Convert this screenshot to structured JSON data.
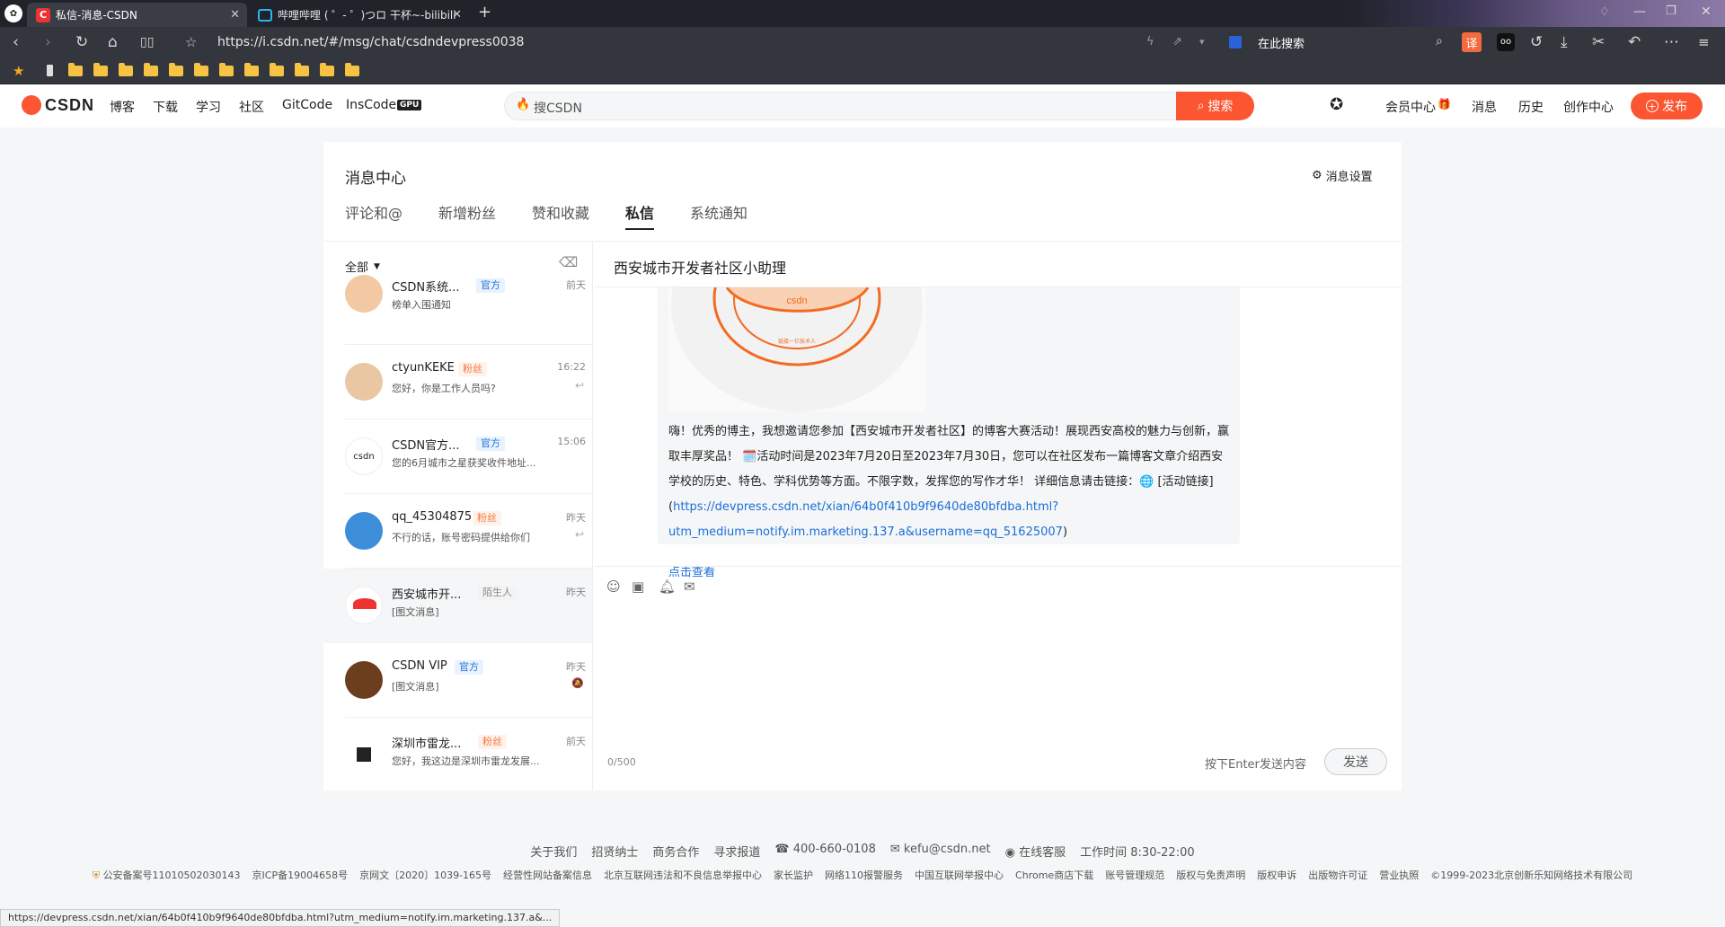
{
  "browser": {
    "tabs": [
      {
        "title": "私信-消息-CSDN"
      },
      {
        "title": "哔哩哔哩 ( ゜- ゜)つロ 干杯~-bilibili"
      }
    ],
    "new_tab": "+",
    "url": "https://i.csdn.net/#/msg/chat/csdndevpress0038",
    "search_placeholder": "在此搜索",
    "translate_label": "译",
    "status_url": "https://devpress.csdn.net/xian/64b0f410b9f9640de80bfdba.html?utm_medium=notify.im.marketing.137.a&..."
  },
  "csdn": {
    "logo": "CSDN",
    "nav": [
      "博客",
      "下载",
      "学习",
      "社区",
      "GitCode",
      "InsCode"
    ],
    "gpu_badge": "GPU",
    "search_placeholder": "搜CSDN",
    "search_button": "搜索",
    "right_nav": [
      "会员中心",
      "消息",
      "历史",
      "创作中心"
    ],
    "publish": "发布"
  },
  "message_center": {
    "title": "消息中心",
    "settings": "消息设置",
    "tabs": [
      "评论和@",
      "新增粉丝",
      "赞和收藏",
      "私信",
      "系统通知"
    ],
    "active_tab": "私信",
    "filter": "全部",
    "conversations": [
      {
        "name": "CSDN系统...",
        "badge": "官方",
        "preview": "榜单入围通知",
        "time": "前天"
      },
      {
        "name": "ctyunKEKE",
        "badge": "粉丝",
        "preview": "您好，你是工作人员吗?",
        "time": "16:22"
      },
      {
        "name": "CSDN官方...",
        "badge": "官方",
        "preview": "您的6月城市之星获奖收件地址...",
        "time": "15:06"
      },
      {
        "name": "qq_45304875",
        "badge": "粉丝",
        "preview": "不行的话，账号密码提供给你们",
        "time": "昨天"
      },
      {
        "name": "西安城市开...",
        "badge": "陌生人",
        "preview": "[图文消息]",
        "time": "昨天"
      },
      {
        "name": "CSDN VIP",
        "badge": "官方",
        "preview": "[图文消息]",
        "time": "昨天"
      },
      {
        "name": "深圳市雷龙...",
        "badge": "粉丝",
        "preview": "您好，我这边是深圳市雷龙发展...",
        "time": "前天"
      }
    ],
    "chat": {
      "title": "西安城市开发者社区小助理",
      "text_before": "嗨！优秀的博主，我想邀请您参加【西安城市开发者社区】的博客大赛活动！展现西安高校的魅力与创新，赢取丰厚奖品！ 🗓️活动时间是2023年7月20日至2023年7月30日，您可以在社区发布一篇博客文章介绍西安学校的历史、特色、学科优势等方面。不限字数，发挥您的写作才华！ 详细信息请击链接：🌐 [活动链接](",
      "link": "https://devpress.csdn.net/xian/64b0f410b9f9640de80bfdba.html?utm_medium=notify.im.marketing.137.a&username=qq_51625007",
      "text_after": ")",
      "view_link": "点击查看",
      "image_brand": "csdn",
      "image_ring": "链接一亿技术人",
      "counter": "0/500",
      "hint": "按下Enter发送内容",
      "send": "发送"
    }
  },
  "footer": {
    "row1": [
      "关于我们",
      "招贤纳士",
      "商务合作",
      "寻求报道",
      "400-660-0108",
      "kefu@csdn.net",
      "在线客服",
      "工作时间 8:30-22:00"
    ],
    "row2": [
      "公安备案号11010502030143",
      "京ICP备19004658号",
      "京网文〔2020〕1039-165号",
      "经营性网站备案信息",
      "北京互联网违法和不良信息举报中心",
      "家长监护",
      "网络110报警服务",
      "中国互联网举报中心",
      "Chrome商店下载",
      "账号管理规范",
      "版权与免责声明",
      "版权申诉",
      "出版物许可证",
      "营业执照",
      "©1999-2023北京创新乐知网络技术有限公司"
    ]
  },
  "colors": {
    "accent": "#fc5531",
    "link": "#1a6fd8"
  }
}
